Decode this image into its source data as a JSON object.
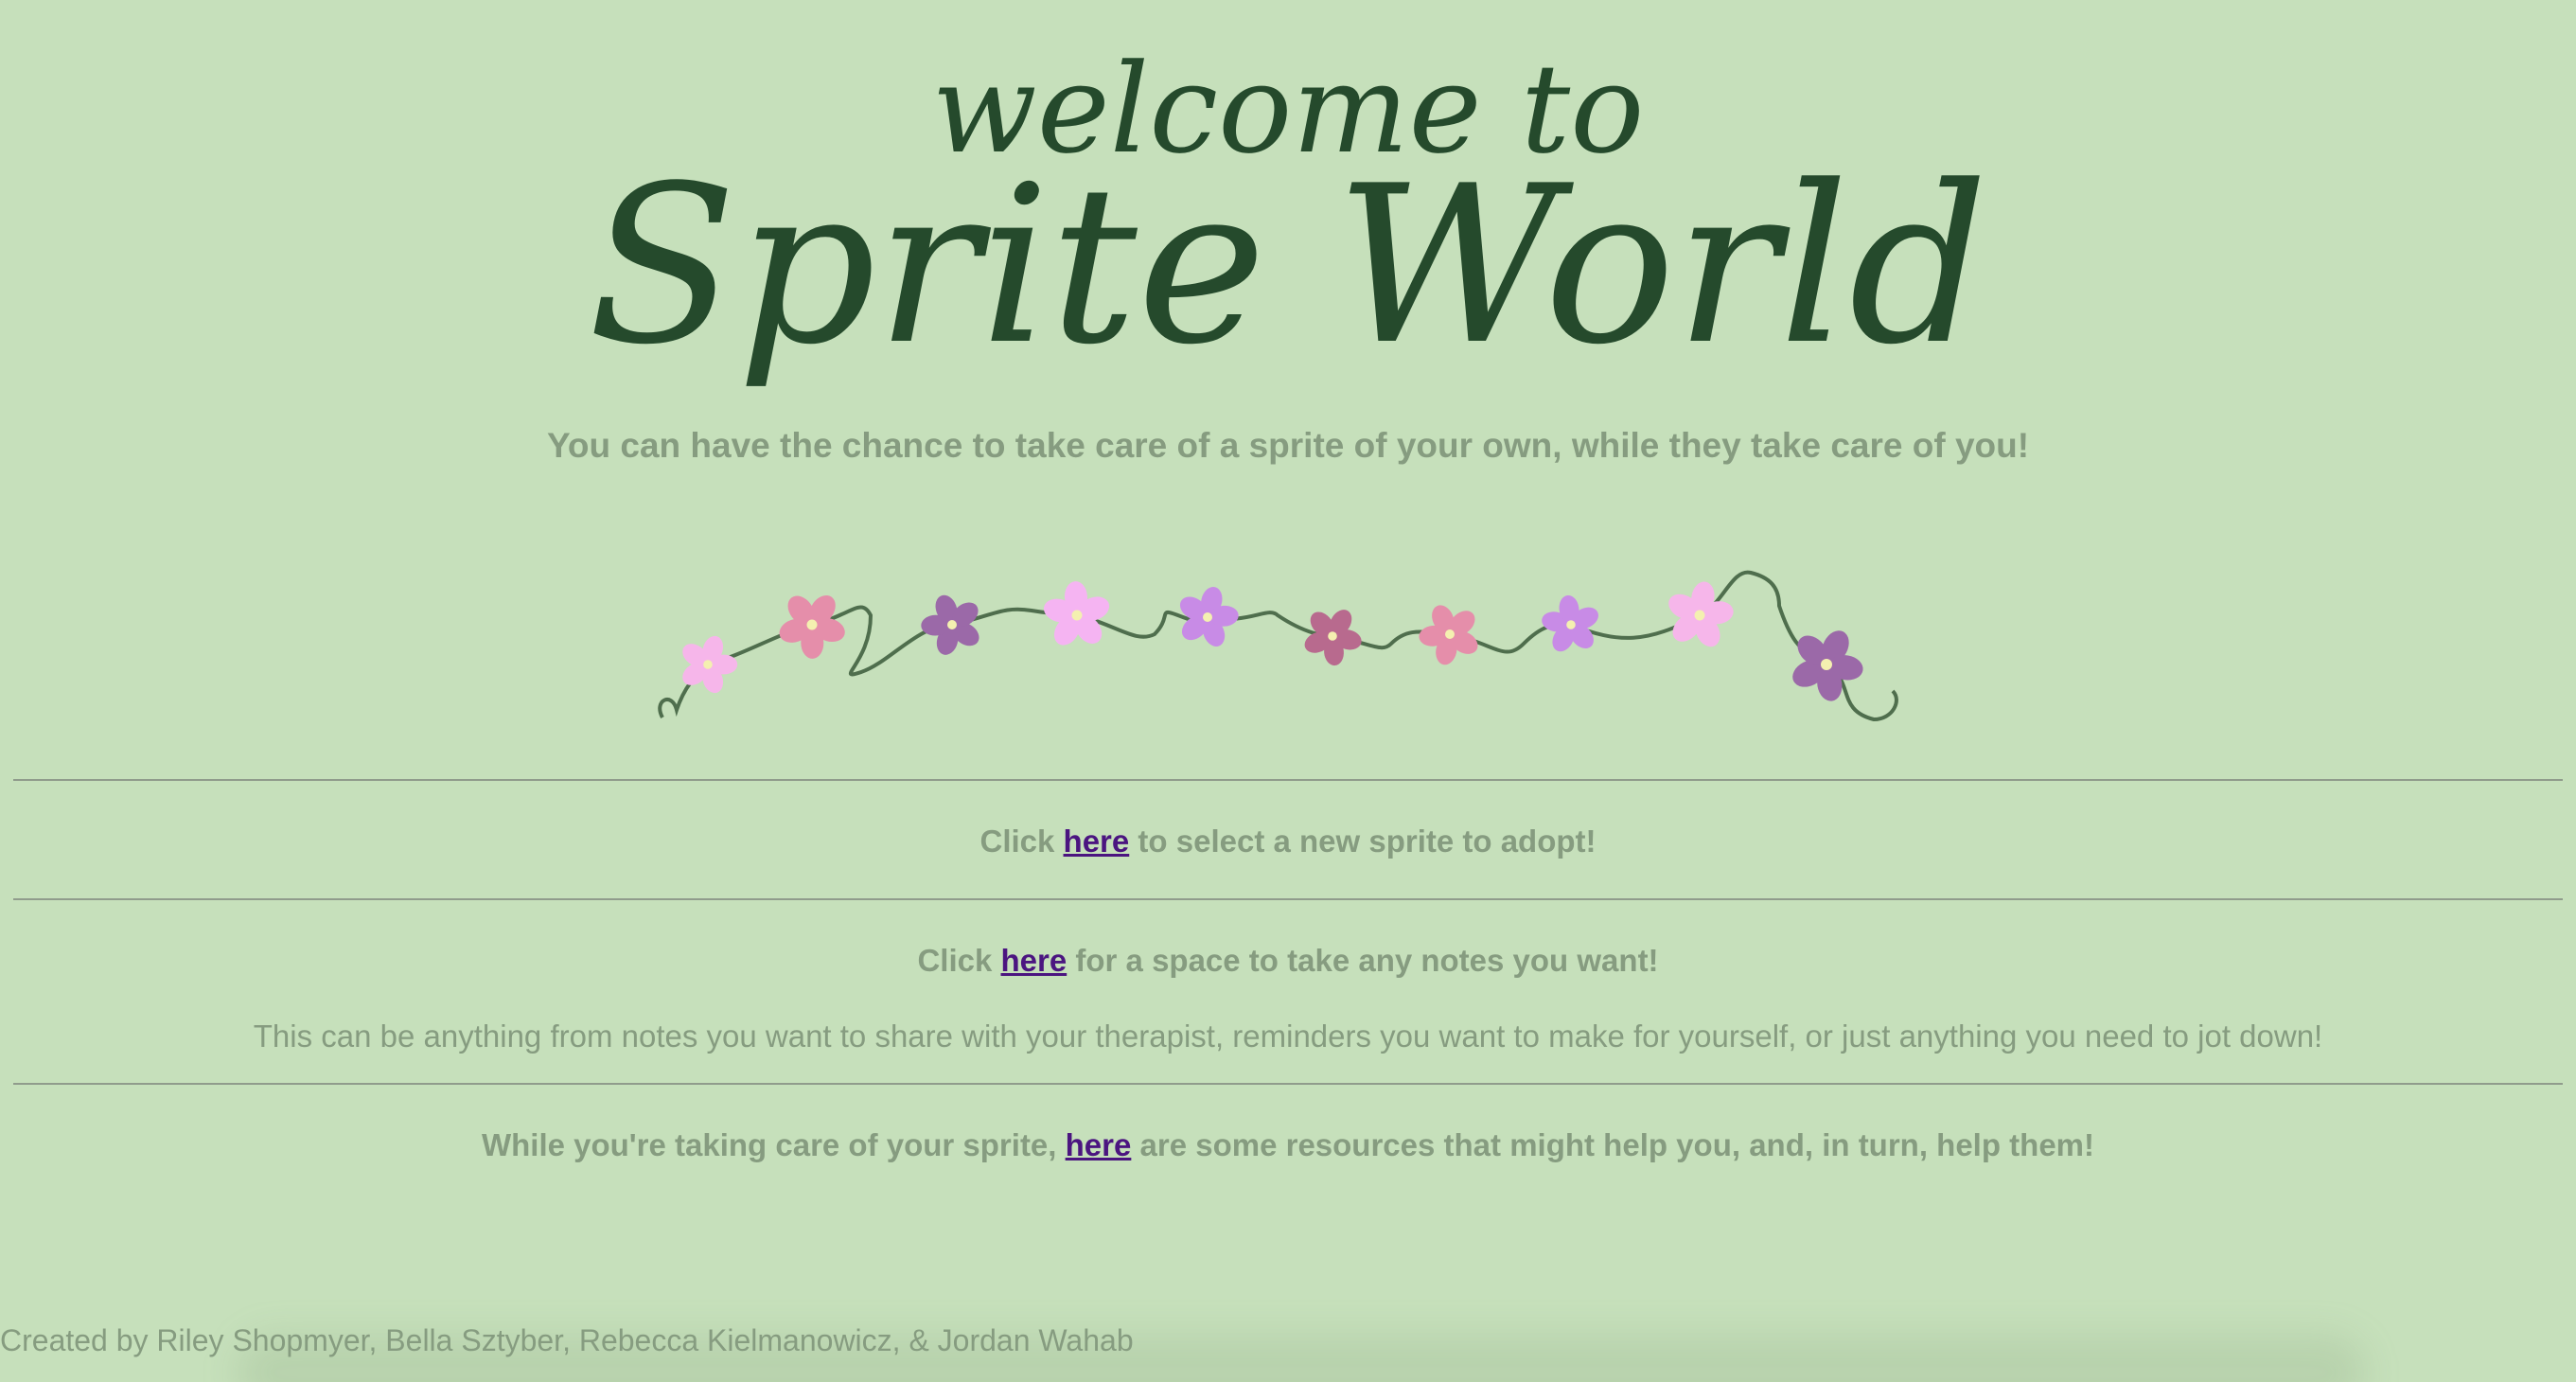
{
  "header": {
    "welcome_text": "welcome to",
    "site_title": "Sprite World"
  },
  "intro": {
    "tagline": "You can have the chance to take care of a sprite of your own, while they take care of you!"
  },
  "decor": {
    "icon": "flower-garland",
    "flower_colors": [
      "#f6b6ea",
      "#e58eaa",
      "#9b69a8",
      "#f5b4f2",
      "#c88be6",
      "#b86a8e",
      "#e58eaa",
      "#c88be6",
      "#f6b6ea",
      "#9b69a8"
    ],
    "vine_color": "#4f6e4d"
  },
  "sections": {
    "adopt": {
      "prefix": "Click ",
      "link": "here",
      "suffix": " to select a new sprite to adopt!"
    },
    "notes": {
      "prefix": "Click ",
      "link": "here",
      "suffix": " for a space to take any notes you want!",
      "description": "This can be anything from notes you want to share with your therapist, reminders you want to make for yourself, or just anything you need to jot down!"
    },
    "resources": {
      "prefix": "While you're taking care of your sprite, ",
      "link": "here",
      "suffix": " are some resources that might help you, and, in turn, help them!"
    }
  },
  "footer": {
    "credits": "Created by Riley Shopmyer, Bella Sztyber, Rebecca Kielmanowicz, & Jordan Wahab"
  },
  "colors": {
    "background": "#c6e0bb",
    "title": "#254a2c",
    "text": "#869c80",
    "link": "#4b1580"
  }
}
